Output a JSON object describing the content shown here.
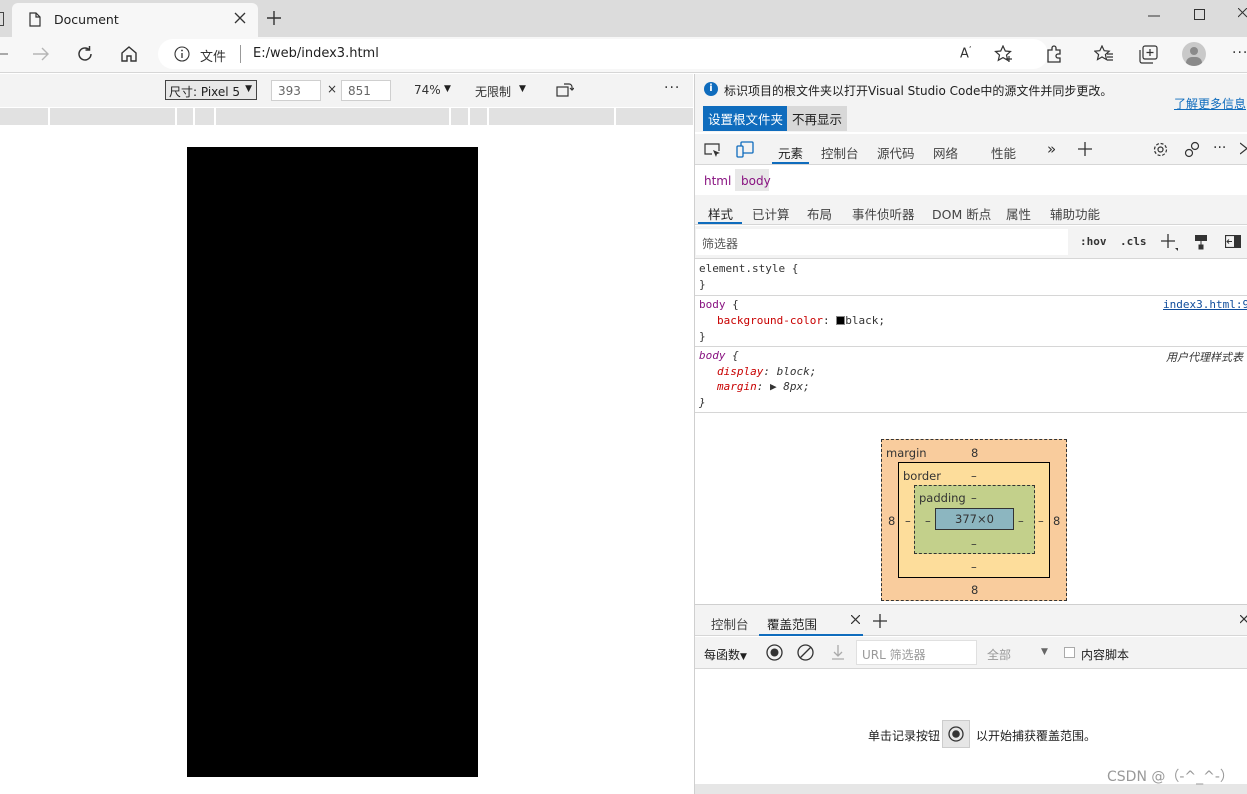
{
  "browser": {
    "tab_title": "Document",
    "address_scheme": "文件",
    "address_url": "E:/web/index3.html"
  },
  "device_toolbar": {
    "device_label": "尺寸: Pixel 5",
    "width": "393",
    "times": "×",
    "height": "851",
    "zoom": "74%",
    "throttle": "无限制"
  },
  "devtools": {
    "info_message": "标识项目的根文件夹以打开Visual Studio Code中的源文件并同步更改。",
    "info_link": "了解更多信息",
    "set_root_button": "设置根文件夹",
    "dont_show_button": "不再显示",
    "main_tabs": [
      "元素",
      "控制台",
      "源代码",
      "网络",
      "性能"
    ],
    "breadcrumbs": [
      "html",
      "body"
    ],
    "sub_tabs": [
      "样式",
      "已计算",
      "布局",
      "事件侦听器",
      "DOM 断点",
      "属性",
      "辅助功能"
    ],
    "filter_placeholder": "筛选器",
    "hov": ":hov",
    "cls": ".cls",
    "rules": {
      "element_style_open": "element.style {",
      "close": "}",
      "rule1_selector": "body",
      "rule1_source": "index3.html:9",
      "rule1_prop": "background-color",
      "rule1_value": "black",
      "rule2_selector": "body",
      "rule2_source": "用户代理样式表",
      "rule2_prop1": "display",
      "rule2_value1": "block",
      "rule2_prop2": "margin",
      "rule2_value2": "8px"
    },
    "box_model": {
      "margin_label": "margin",
      "margin_top": "8",
      "margin_bottom": "8",
      "margin_left": "8",
      "margin_right": "8",
      "border_label": "border",
      "border_value": "–",
      "padding_label": "padding",
      "padding_value": "–",
      "content": "377×0"
    },
    "drawer_tabs": [
      "控制台",
      "覆盖范围"
    ],
    "coverage": {
      "per_function": "每函数",
      "url_filter_placeholder": "URL 筛选器",
      "all": "全部",
      "content_scripts": "内容脚本",
      "message_before": "单击记录按钮",
      "message_after": "以开始捕获覆盖范围。"
    }
  },
  "watermark": "CSDN @（-^_^-）"
}
